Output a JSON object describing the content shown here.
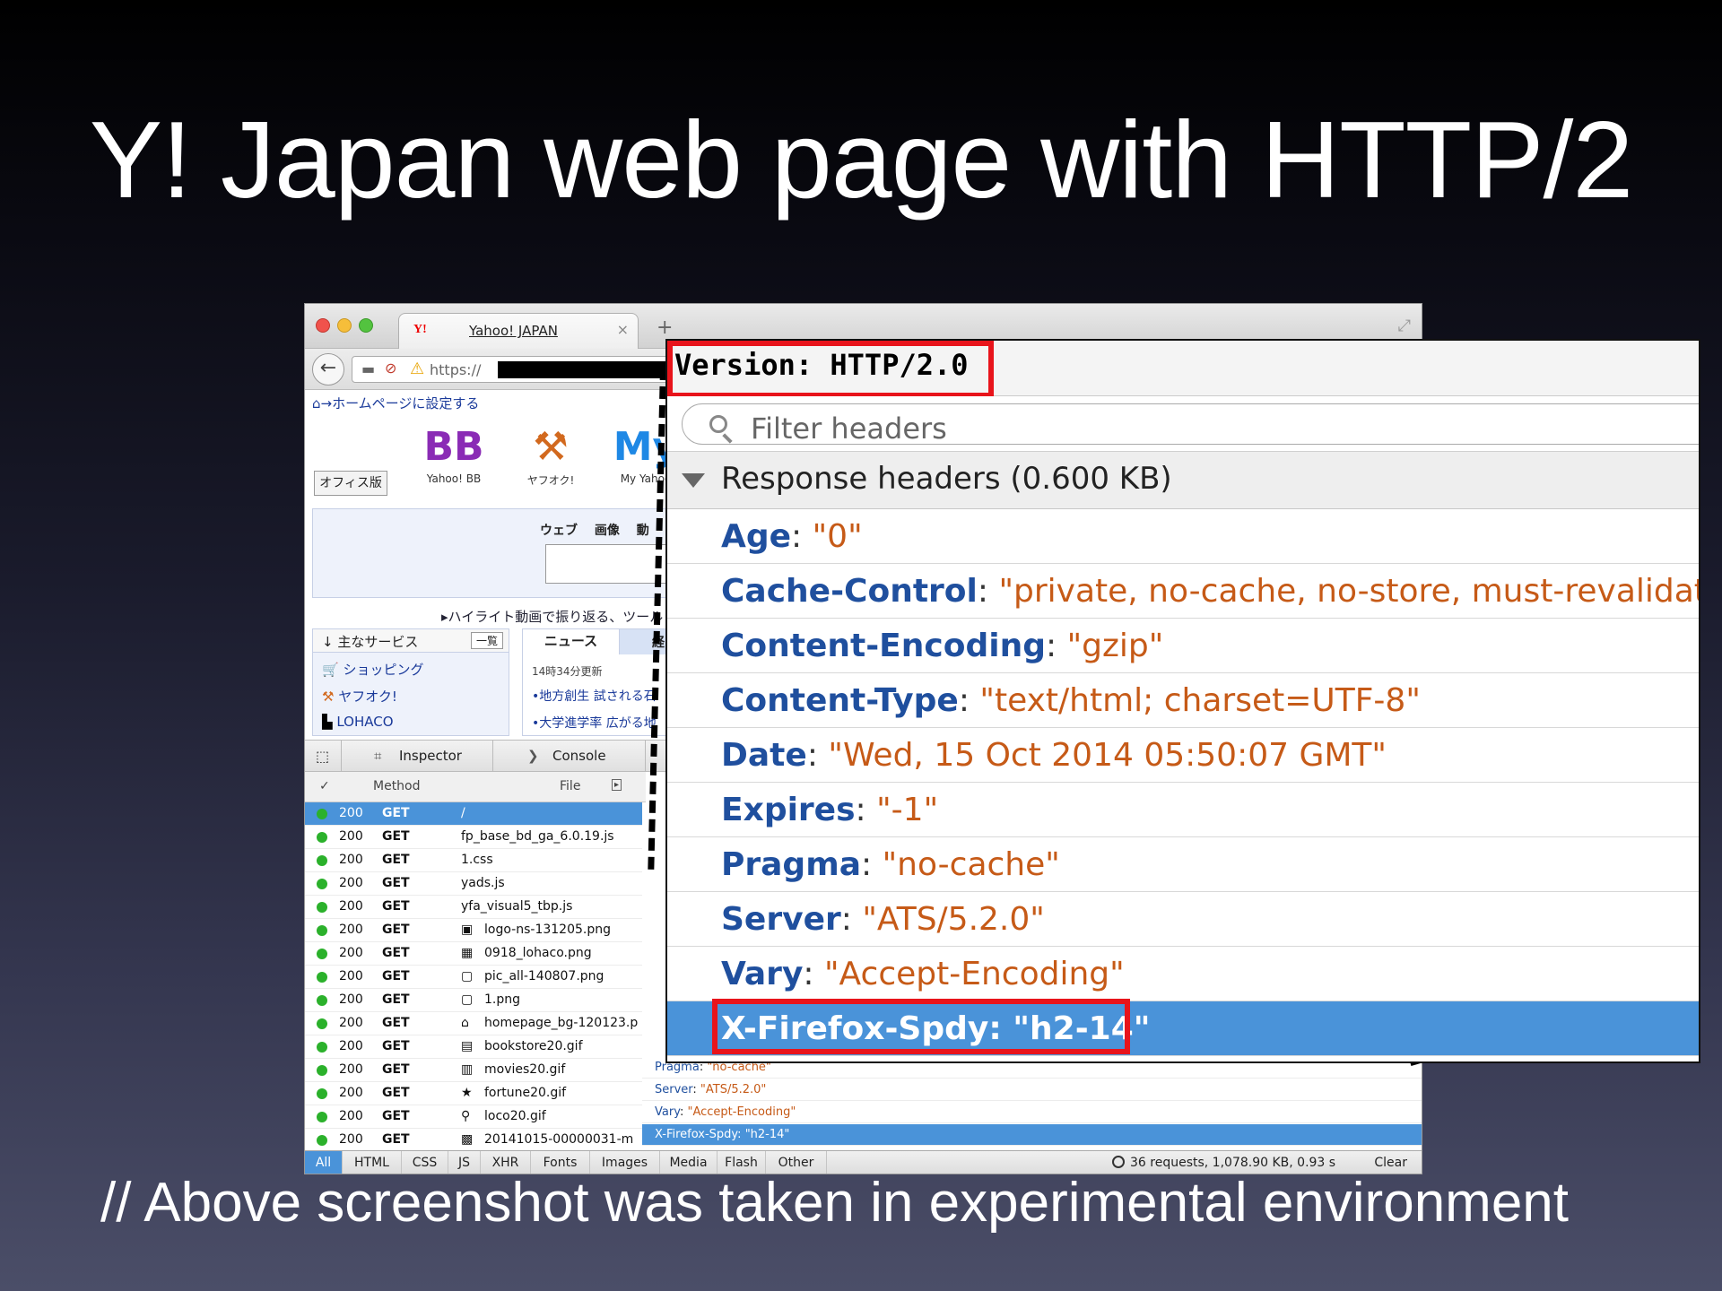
{
  "slide": {
    "title": "Y! Japan web page with HTTP/2",
    "footnote": "// Above screenshot was taken in experimental environment"
  },
  "browser": {
    "tab_title": "Yahoo! JAPAN",
    "tab_logo": "Y!",
    "url_prefix": "https://",
    "home_link": "ホームページに設定する",
    "office_button": "オフィス版",
    "services": [
      {
        "logo": "BB",
        "label": "Yahoo! BB",
        "color": "#8a2bb5"
      },
      {
        "logo": "⚒",
        "label": "ヤフオク!",
        "color": "#d2691e"
      },
      {
        "logo": "My",
        "label": "My Yahoo",
        "color": "#1e88e5"
      }
    ],
    "search_tabs": "ウェブ 画像 動",
    "highlight_link": "ハイライト動画で振り返る、ツール",
    "main_services": {
      "title": "主なサービス",
      "more": "一覧",
      "items": [
        "ショッピング",
        "ヤフオク!",
        "LOHACO"
      ]
    },
    "news": {
      "tab": "ニュース",
      "tab2": "経",
      "updated": "14時34分更新",
      "items": [
        "•地方創生 試される石",
        "•大学進学率 広がる地"
      ]
    }
  },
  "devtools": {
    "tabs": [
      "Inspector",
      "Console"
    ],
    "columns": {
      "check": "✓",
      "method": "Method",
      "file": "File"
    },
    "requests": [
      {
        "status": "200",
        "method": "GET",
        "file": "/",
        "icon": ""
      },
      {
        "status": "200",
        "method": "GET",
        "file": "fp_base_bd_ga_6.0.19.js",
        "icon": ""
      },
      {
        "status": "200",
        "method": "GET",
        "file": "1.css",
        "icon": ""
      },
      {
        "status": "200",
        "method": "GET",
        "file": "yads.js",
        "icon": ""
      },
      {
        "status": "200",
        "method": "GET",
        "file": "yfa_visual5_tbp.js",
        "icon": ""
      },
      {
        "status": "200",
        "method": "GET",
        "file": "logo-ns-131205.png",
        "icon": "▣"
      },
      {
        "status": "200",
        "method": "GET",
        "file": "0918_lohaco.png",
        "icon": "▦"
      },
      {
        "status": "200",
        "method": "GET",
        "file": "pic_all-140807.png",
        "icon": "▢"
      },
      {
        "status": "200",
        "method": "GET",
        "file": "1.png",
        "icon": "▢"
      },
      {
        "status": "200",
        "method": "GET",
        "file": "homepage_bg-120123.p",
        "icon": "⌂"
      },
      {
        "status": "200",
        "method": "GET",
        "file": "bookstore20.gif",
        "icon": "▤"
      },
      {
        "status": "200",
        "method": "GET",
        "file": "movies20.gif",
        "icon": "▥"
      },
      {
        "status": "200",
        "method": "GET",
        "file": "fortune20.gif",
        "icon": "★"
      },
      {
        "status": "200",
        "method": "GET",
        "file": "loco20.gif",
        "icon": "⚲"
      },
      {
        "status": "200",
        "method": "GET",
        "file": "20141015-00000031-m",
        "icon": "▩"
      }
    ],
    "mini_headers": [
      {
        "key": "Pragma",
        "value": "\"no-cache\""
      },
      {
        "key": "Server",
        "value": "\"ATS/5.2.0\""
      },
      {
        "key": "Vary",
        "value": "\"Accept-Encoding\""
      },
      {
        "key": "X-Firefox-Spdy",
        "value": "\"h2-14\""
      }
    ],
    "filters": [
      "All",
      "HTML",
      "CSS",
      "JS",
      "XHR",
      "Fonts",
      "Images",
      "Media",
      "Flash",
      "Other"
    ],
    "summary": "36 requests, 1,078.90 KB, 0.93 s",
    "clear": "Clear"
  },
  "zoom": {
    "version": "Version: HTTP/2.0",
    "filter_placeholder": "Filter headers",
    "section": "Response headers (0.600 KB)",
    "headers": [
      {
        "key": "Age",
        "value": "\"0\""
      },
      {
        "key": "Cache-Control",
        "value": "\"private, no-cache, no-store, must-revalidate\""
      },
      {
        "key": "Content-Encoding",
        "value": "\"gzip\""
      },
      {
        "key": "Content-Type",
        "value": "\"text/html; charset=UTF-8\""
      },
      {
        "key": "Date",
        "value": "\"Wed, 15 Oct 2014 05:50:07 GMT\""
      },
      {
        "key": "Expires",
        "value": "\"-1\""
      },
      {
        "key": "Pragma",
        "value": "\"no-cache\""
      },
      {
        "key": "Server",
        "value": "\"ATS/5.2.0\""
      },
      {
        "key": "Vary",
        "value": "\"Accept-Encoding\""
      },
      {
        "key": "X-Firefox-Spdy",
        "value": "\"h2-14\""
      }
    ]
  }
}
